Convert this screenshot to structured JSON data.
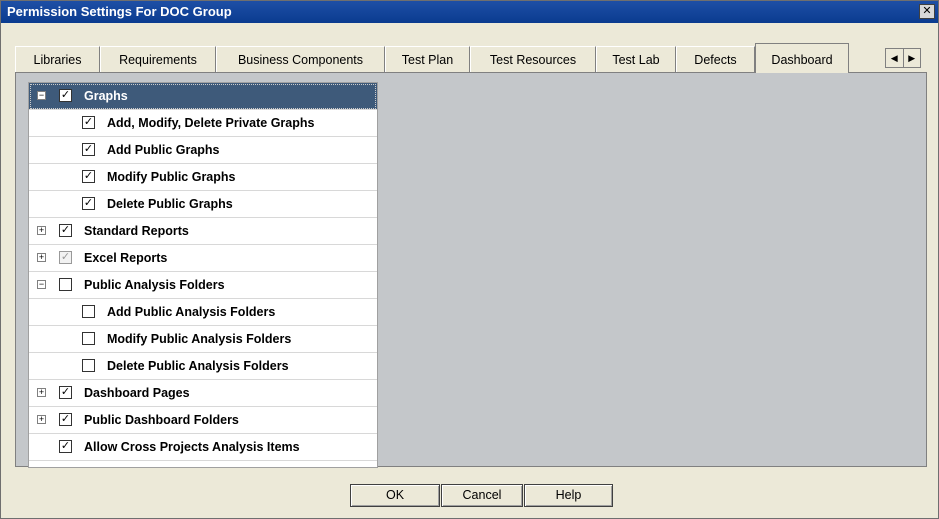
{
  "window": {
    "title": "Permission Settings For DOC Group",
    "close_glyph": "✕"
  },
  "tabs": [
    {
      "label": "Libraries"
    },
    {
      "label": "Requirements"
    },
    {
      "label": "Business Components"
    },
    {
      "label": "Test Plan"
    },
    {
      "label": "Test Resources"
    },
    {
      "label": "Test Lab"
    },
    {
      "label": "Defects"
    },
    {
      "label": "Dashboard",
      "active": true
    }
  ],
  "tab_scroll": {
    "left": "◀",
    "right": "▶"
  },
  "tree": {
    "rows": [
      {
        "label": "Graphs",
        "expander": "−",
        "checked": "✓",
        "level": 0,
        "selected": true
      },
      {
        "label": "Add, Modify, Delete Private Graphs",
        "checked": "✓",
        "level": 1
      },
      {
        "label": "Add Public Graphs",
        "checked": "✓",
        "level": 1
      },
      {
        "label": "Modify Public Graphs",
        "checked": "✓",
        "level": 1
      },
      {
        "label": "Delete Public Graphs",
        "checked": "✓",
        "level": 1
      },
      {
        "label": "Standard Reports",
        "expander": "+",
        "checked": "✓",
        "level": 0
      },
      {
        "label": "Excel Reports",
        "expander": "+",
        "checked": "✓",
        "level": 0,
        "disabled": true
      },
      {
        "label": "Public Analysis Folders",
        "expander": "−",
        "checked": "",
        "level": 0
      },
      {
        "label": "Add Public Analysis Folders",
        "checked": "",
        "level": 1
      },
      {
        "label": "Modify Public Analysis Folders",
        "checked": "",
        "level": 1
      },
      {
        "label": "Delete Public Analysis Folders",
        "checked": "",
        "level": 1
      },
      {
        "label": "Dashboard Pages",
        "expander": "+",
        "checked": "✓",
        "level": 0
      },
      {
        "label": "Public Dashboard Folders",
        "expander": "+",
        "checked": "✓",
        "level": 0
      },
      {
        "label": "Allow Cross Projects Analysis Items",
        "checked": "✓",
        "level": 0,
        "no_expander": true
      }
    ]
  },
  "buttons": {
    "ok": "OK",
    "cancel": "Cancel",
    "help": "Help"
  }
}
